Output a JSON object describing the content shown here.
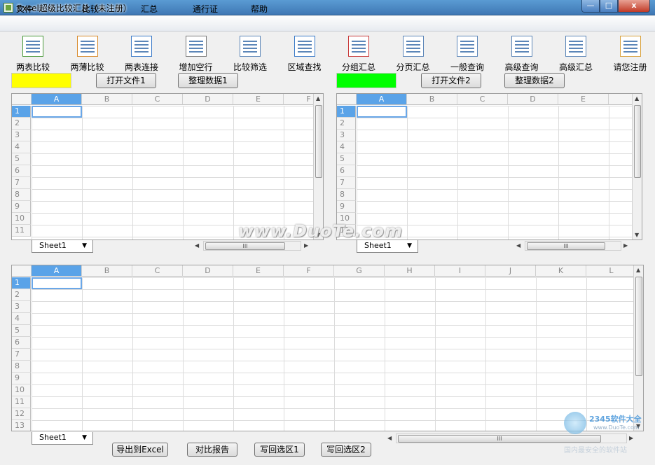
{
  "window": {
    "title": "Excel超级比较汇总（未注册）",
    "min": "—",
    "max": "□",
    "close": "x"
  },
  "menu": [
    "文件",
    "比较",
    "汇总",
    "通行证",
    "帮助"
  ],
  "toolbar": [
    {
      "label": "两表比较",
      "icon": "two-sheets-compare-icon"
    },
    {
      "label": "两薄比较",
      "icon": "two-books-compare-icon"
    },
    {
      "label": "两表连接",
      "icon": "join-sheets-icon"
    },
    {
      "label": "增加空行",
      "icon": "add-blank-rows-icon"
    },
    {
      "label": "比较筛选",
      "icon": "compare-filter-icon"
    },
    {
      "label": "区域查找",
      "icon": "region-search-icon"
    },
    {
      "label": "分组汇总",
      "icon": "group-summary-icon"
    },
    {
      "label": "分页汇总",
      "icon": "page-summary-icon"
    },
    {
      "label": "一般查询",
      "icon": "general-query-icon"
    },
    {
      "label": "高级查询",
      "icon": "advanced-query-icon"
    },
    {
      "label": "高级汇总",
      "icon": "advanced-summary-icon"
    },
    {
      "label": "请您注册",
      "icon": "register-icon"
    }
  ],
  "panel1": {
    "open_label": "打开文件1",
    "tidy_label": "整理数据1",
    "color": "#ffff00",
    "sheet": "Sheet1"
  },
  "panel2": {
    "open_label": "打开文件2",
    "tidy_label": "整理数据2",
    "color": "#00ff00",
    "sheet": "Sheet1"
  },
  "top_cols": [
    "A",
    "B",
    "C",
    "D",
    "E",
    "F"
  ],
  "top_rows": [
    "1",
    "2",
    "3",
    "4",
    "5",
    "6",
    "7",
    "8",
    "9",
    "10",
    "11"
  ],
  "bottom_cols": [
    "A",
    "B",
    "C",
    "D",
    "E",
    "F",
    "G",
    "H",
    "I",
    "J",
    "K",
    "L"
  ],
  "bottom_rows": [
    "1",
    "2",
    "3",
    "4",
    "5",
    "6",
    "7",
    "8",
    "9",
    "10",
    "11",
    "12",
    "13"
  ],
  "bottom": {
    "sheet": "Sheet1",
    "export_label": "导出到Excel",
    "report_label": "对比报告",
    "write1_label": "写回选区1",
    "write2_label": "写回选区2"
  },
  "scroll_grip": "III",
  "watermark": "www.DuoTe.com",
  "logo": {
    "text": "2345软件大全",
    "sub": "国内最安全的软件站",
    "url": "www.DuoTe.com"
  }
}
